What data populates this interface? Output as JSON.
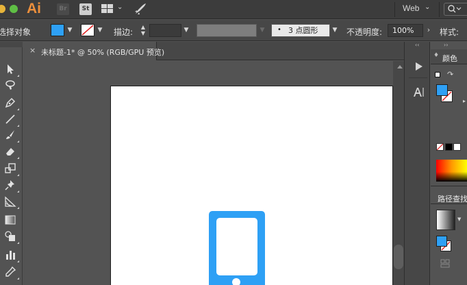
{
  "app": {
    "logo_text": "Ai",
    "bridge_label": "Br",
    "stock_label": "St",
    "workspace_label": "Web"
  },
  "control_bar": {
    "selection_label": "选择对象",
    "stroke_label": "描边:",
    "brush_label": "3 点圆形",
    "opacity_label": "不透明度:",
    "opacity_value": "100%",
    "style_label": "样式:"
  },
  "document": {
    "tab_title": "未标题-1* @ 50% (RGB/GPU 预览)",
    "close_glyph": "×"
  },
  "right_dock": {
    "color_tab_label": "颜色",
    "pathfinder_label": "路径查找"
  },
  "colors": {
    "fill": "#2ea0f5",
    "ai_brand": "#ec8f3c",
    "phone_icon": "#2ea0f5"
  }
}
